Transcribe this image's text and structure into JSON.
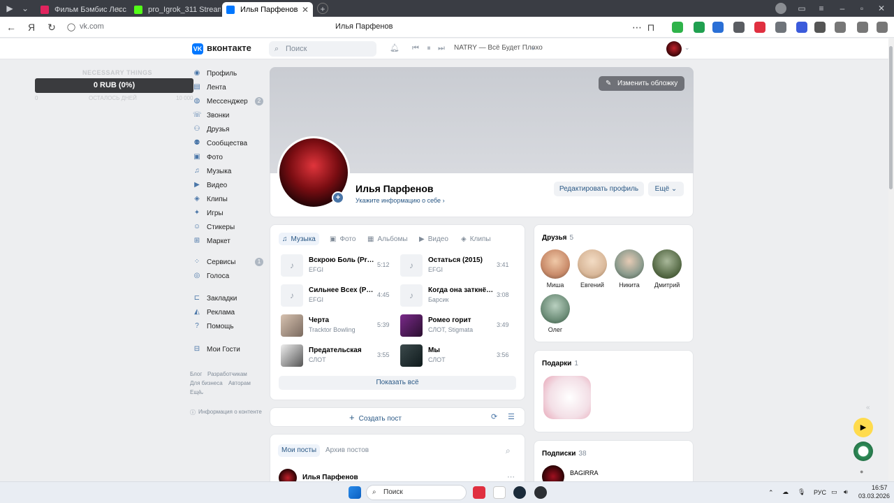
{
  "browser": {
    "tabs": [
      {
        "title": "Фильм Бэмбис Лесс..."
      },
      {
        "title": "pro_Igrok_311 Stream - W..."
      },
      {
        "title": "Илья Парфенов"
      }
    ],
    "url": "vk.com",
    "page_title": "Илья Парфенов"
  },
  "vk": {
    "logo": "вконтакте",
    "search_placeholder": "Поиск",
    "now_playing": "NATRY — Всё Будет Плохо"
  },
  "widget": {
    "title": "NECESSARY THINGS",
    "amount": "0 RUB (0%)",
    "left": "0",
    "middle": "ОСТАЛОСЬ ДНЕЙ",
    "right": "10 000"
  },
  "sidebar": {
    "items": [
      {
        "label": "Профиль",
        "icon": "user-icon"
      },
      {
        "label": "Лента",
        "icon": "feed-icon"
      },
      {
        "label": "Мессенджер",
        "icon": "message-icon",
        "badge": "2"
      },
      {
        "label": "Звонки",
        "icon": "phone-icon"
      },
      {
        "label": "Друзья",
        "icon": "friends-icon"
      },
      {
        "label": "Сообщества",
        "icon": "communities-icon"
      },
      {
        "label": "Фото",
        "icon": "photo-icon"
      },
      {
        "label": "Музыка",
        "icon": "music-icon"
      },
      {
        "label": "Видео",
        "icon": "video-icon"
      },
      {
        "label": "Клипы",
        "icon": "clips-icon"
      },
      {
        "label": "Игры",
        "icon": "games-icon"
      },
      {
        "label": "Стикеры",
        "icon": "stickers-icon"
      },
      {
        "label": "Маркет",
        "icon": "market-icon"
      },
      {
        "label": "Сервисы",
        "icon": "services-icon",
        "badge": "1"
      },
      {
        "label": "Голоса",
        "icon": "votes-icon"
      },
      {
        "label": "Закладки",
        "icon": "bookmarks-icon"
      },
      {
        "label": "Реклама",
        "icon": "ads-icon"
      },
      {
        "label": "Помощь",
        "icon": "help-icon"
      },
      {
        "label": "Мои Гости",
        "icon": "guests-icon"
      }
    ],
    "footer": {
      "blog": "Блог",
      "developers": "Разработчикам",
      "business": "Для бизнеса",
      "authors": "Авторам",
      "more": "Ещё",
      "info": "Информация о контенте"
    }
  },
  "profile": {
    "cover_button": "Изменить обложку",
    "name": "Илья Парфенов",
    "info_link": "Укажите информацию о себе",
    "edit_button": "Редактировать профиль",
    "more_button": "Ещё"
  },
  "music": {
    "tabs": [
      "Музыка",
      "Фото",
      "Альбомы",
      "Видео",
      "Клипы"
    ],
    "tracks": [
      {
        "title": "Вскрою Боль (Prod...",
        "artist": "EFGI",
        "duration": "5:12"
      },
      {
        "title": "Сильнее Всех (Pro...",
        "artist": "EFGI",
        "duration": "4:45"
      },
      {
        "title": "Черта",
        "artist": "Tracktor Bowling",
        "duration": "5:39"
      },
      {
        "title": "Предательская",
        "artist": "СЛОТ",
        "duration": "3:55"
      },
      {
        "title": "Остаться (2015)",
        "artist": "EFGI",
        "duration": "3:41"
      },
      {
        "title": "Когда она заткнётся",
        "artist": "Барсик",
        "duration": "3:08"
      },
      {
        "title": "Ромео горит",
        "artist": "СЛОТ, Stigmata",
        "duration": "3:49"
      },
      {
        "title": "Мы",
        "artist": "СЛОТ",
        "duration": "3:56"
      }
    ],
    "show_all": "Показать всё"
  },
  "create_post": "Создать пост",
  "posts": {
    "tab_mine": "Мои посты",
    "tab_archive": "Архив постов",
    "first_author": "Илья Парфенов"
  },
  "friends": {
    "title": "Друзья",
    "count": "5",
    "list": [
      {
        "name": "Миша",
        "color": "#c98b6a"
      },
      {
        "name": "Евгений",
        "color": "#d9b89a"
      },
      {
        "name": "Никита",
        "color": "#8a9a8c"
      },
      {
        "name": "Дмитрий",
        "color": "#5a6e4a"
      },
      {
        "name": "Олег",
        "color": "#6f8f7a"
      }
    ]
  },
  "gifts": {
    "title": "Подарки",
    "count": "1"
  },
  "subscriptions": {
    "title": "Подписки",
    "count": "38",
    "first": "BAGIRRA"
  },
  "taskbar": {
    "search": "Поиск",
    "lang": "РУС",
    "time": "16:57",
    "date": "03.03.2026"
  },
  "colors": {
    "accent": "#2a5885",
    "vk_blue": "#0077ff"
  }
}
